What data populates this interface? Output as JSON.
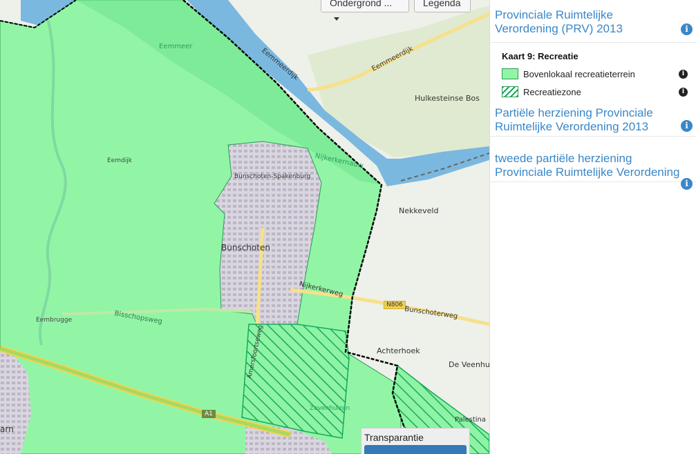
{
  "map": {
    "buttons": {
      "basemap": "Ondergrond ...",
      "legend": "Legenda"
    },
    "transparency_label": "Transparantie",
    "labels": [
      "Eemmeer",
      "Eemmeerdijk",
      "Eemmeerdijk",
      "Hulkesteinse Bos",
      "Eemdijk",
      "Nijkerkernauw",
      "Bunschoten-Spakenburg",
      "Bunschoten",
      "Nekkeveld",
      "Nijkerkerweg",
      "N806",
      "Bunschoterweg",
      "Bisschopsweg",
      "Eemb­rugge",
      "Achterhoek",
      "De Veenhuis",
      "Amersfoortseweg",
      "A1",
      "Zevenhuizen",
      "Palestina",
      "arn"
    ],
    "colors": {
      "recreation_area": "#92f5a6",
      "recreation_zone_hatch": "#16a95a",
      "water": "#7ab8e0",
      "boundary": "#000000"
    }
  },
  "panel": {
    "sections": [
      {
        "title": "Provinciale Ruimtelijke Verordening (PRV) 2013",
        "icon": "info-icon"
      },
      {
        "title": "Partiële herziening Provinciale Ruimtelijke Verordening 2013",
        "icon": "info-icon"
      },
      {
        "title": "tweede partiële herziening Provinciale Ruimtelijke Verordening",
        "icon": "info-icon"
      }
    ],
    "legend": {
      "title": "Kaart 9: Recreatie",
      "items": [
        {
          "label": "Bovenlokaal recreatieterrein",
          "swatch": "solid-green"
        },
        {
          "label": "Recreatiezone",
          "swatch": "hatched-green"
        }
      ]
    }
  }
}
